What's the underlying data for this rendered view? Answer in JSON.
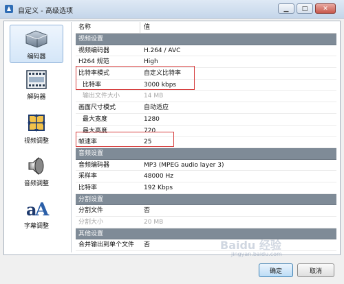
{
  "window": {
    "title": "自定义 - 高级选项",
    "min_icon": "minimize-icon",
    "max_icon": "maximize-icon",
    "close_icon": "close-icon"
  },
  "sidebar": {
    "items": [
      {
        "label": "编码器",
        "icon": "encoder-icon",
        "active": true
      },
      {
        "label": "解码器",
        "icon": "decoder-icon",
        "active": false
      },
      {
        "label": "视频调整",
        "icon": "video-adjust-icon",
        "active": false
      },
      {
        "label": "音频调整",
        "icon": "audio-adjust-icon",
        "active": false
      },
      {
        "label": "字幕调整",
        "icon": "subtitle-adjust-icon",
        "active": false
      }
    ]
  },
  "grid": {
    "headers": [
      "名称",
      "值"
    ],
    "rows": [
      {
        "type": "group",
        "name": "视频设置"
      },
      {
        "name": "视频编码器",
        "value": "H.264 / AVC"
      },
      {
        "name": "H264 规范",
        "value": "High"
      },
      {
        "name": "比特率模式",
        "value": "自定义比特率"
      },
      {
        "name": "比特率",
        "value": "3000 kbps",
        "indent": true
      },
      {
        "name": "输出文件大小",
        "value": "14 MB",
        "indent": true,
        "dim": true
      },
      {
        "name": "画面尺寸模式",
        "value": "自动适应"
      },
      {
        "name": "最大宽度",
        "value": "1280",
        "indent": true
      },
      {
        "name": "最大高度",
        "value": "720",
        "indent": true
      },
      {
        "name": "帧速率",
        "value": "25"
      },
      {
        "type": "group",
        "name": "音频设置"
      },
      {
        "name": "音频编码器",
        "value": "MP3 (MPEG audio layer 3)"
      },
      {
        "name": "采样率",
        "value": "48000 Hz"
      },
      {
        "name": "比特率",
        "value": "192 Kbps"
      },
      {
        "type": "group",
        "name": "分割设置"
      },
      {
        "name": "分割文件",
        "value": "否"
      },
      {
        "name": "分割大小",
        "value": "20 MB",
        "dim": true
      },
      {
        "type": "group",
        "name": "其他设置"
      },
      {
        "name": "合并输出到单个文件",
        "value": "否"
      }
    ]
  },
  "buttons": {
    "ok": "确定",
    "cancel": "取消"
  },
  "watermark": {
    "text": "Baidu 经验",
    "sub": "jingyan.baidu.com"
  },
  "colors": {
    "group_header": "#7f8b97",
    "highlight_box": "#d63c3c",
    "ok_border": "#3c7fb1"
  }
}
